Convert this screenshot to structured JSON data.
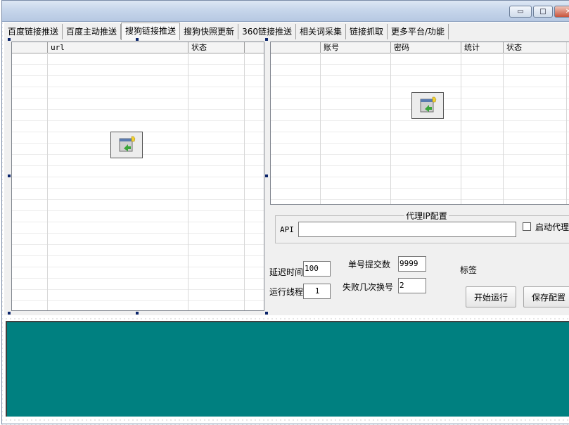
{
  "window": {
    "minimize_glyph": "▭",
    "maximize_glyph": "□",
    "close_glyph": "✕"
  },
  "tabs": [
    {
      "label": "百度链接推送"
    },
    {
      "label": "百度主动推送"
    },
    {
      "label": "搜狗链接推送"
    },
    {
      "label": "搜狗快照更新"
    },
    {
      "label": "360链接推送"
    },
    {
      "label": "相关词采集"
    },
    {
      "label": "链接抓取"
    },
    {
      "label": "更多平台/功能"
    }
  ],
  "url_list": {
    "columns": [
      "",
      "url",
      "状态",
      ""
    ]
  },
  "account_list": {
    "columns": [
      "",
      "账号",
      "密码",
      "统计",
      "状态"
    ]
  },
  "proxy": {
    "title": "代理IP配置",
    "api_label": "API",
    "api_value": "",
    "enable_label": "启动代理"
  },
  "settings": {
    "delay_label": "延迟时间",
    "delay_value": "100",
    "threads_label": "运行线程",
    "threads_value": "1",
    "per_account_label": "单号提交数",
    "per_account_value": "9999",
    "fail_switch_label": "失败几次换号",
    "fail_switch_value": "2",
    "tag_label": "标签"
  },
  "buttons": {
    "start": "开始运行",
    "save": "保存配置"
  }
}
